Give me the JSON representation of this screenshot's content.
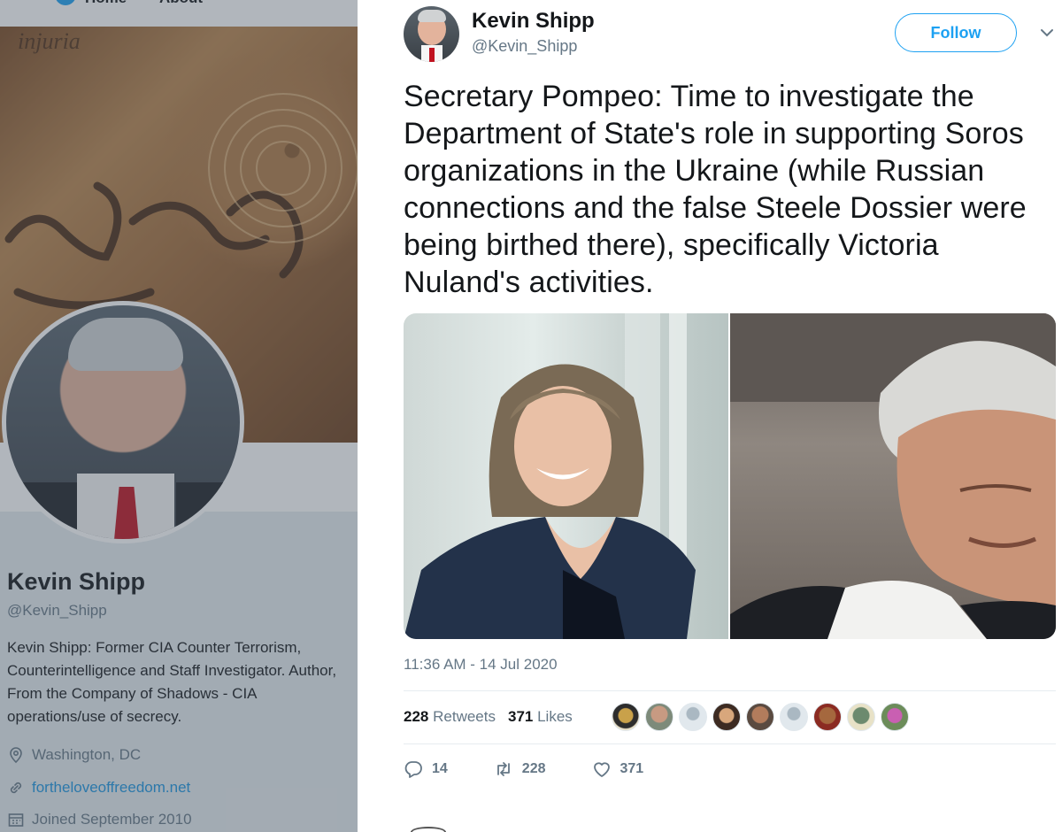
{
  "nav": {
    "home_label": "Home",
    "about_label": "About"
  },
  "profile": {
    "name": "Kevin Shipp",
    "handle": "@Kevin_Shipp",
    "bio": "Kevin Shipp: Former CIA Counter Terrorism, Counterintelligence and Staff Investigator. Author, From the Company of Shadows - CIA operations/use of secrecy.",
    "location": "Washington, DC",
    "website": "fortheloveoffreedom.net",
    "joined": "Joined September 2010"
  },
  "tweet": {
    "author_name": "Kevin Shipp",
    "author_handle": "@Kevin_Shipp",
    "follow_label": "Follow",
    "text": "Secretary Pompeo: Time to investigate the Department of State's role in supporting Soros organizations in the Ukraine (while Russian connections and the false Steele Dossier were being birthed there), specifically Victoria Nuland's activities.",
    "timestamp": "11:36 AM - 14 Jul 2020",
    "retweets_count": "228",
    "retweets_label": "Retweets",
    "likes_count": "371",
    "likes_label": "Likes",
    "replies": "14",
    "retweet_action": "228",
    "like_action": "371"
  },
  "colors": {
    "accent": "#1da1f2",
    "text": "#14171a",
    "muted": "#657786",
    "link": "#1b95e0"
  },
  "icons": {
    "location": "location-pin-icon",
    "link": "link-icon",
    "calendar": "calendar-icon",
    "reply": "reply-icon",
    "retweet": "retweet-icon",
    "like": "heart-icon",
    "caret": "chevron-down-icon"
  }
}
